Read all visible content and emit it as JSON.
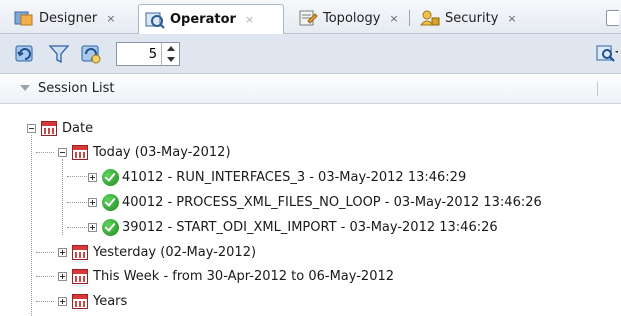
{
  "tabs": [
    {
      "label": "Designer",
      "close": "×",
      "icon": "designer-icon",
      "active": false
    },
    {
      "label": "Operator",
      "close": "×",
      "icon": "operator-icon",
      "active": true
    },
    {
      "label": "Topology",
      "close": "×",
      "icon": "topology-icon",
      "active": false
    },
    {
      "label": "Security",
      "close": "×",
      "icon": "security-icon",
      "active": false
    }
  ],
  "toolbar": {
    "icons": [
      "refresh-icon",
      "filter-icon",
      "connect-icon",
      "search-icon"
    ],
    "count_value": "5"
  },
  "panel": {
    "title": "Session List"
  },
  "tree": {
    "root": {
      "label": "Date",
      "icon": "calendar-icon",
      "expanded": true
    },
    "today": {
      "label": "Today (03-May-2012)",
      "icon": "calendar-icon",
      "expanded": true
    },
    "sessions": [
      {
        "label": "41012 - RUN_INTERFACES_3 - 03-May-2012 13:46:29",
        "status": "success"
      },
      {
        "label": "40012 - PROCESS_XML_FILES_NO_LOOP - 03-May-2012 13:46:26",
        "status": "success"
      },
      {
        "label": "39012 - START_ODI_XML_IMPORT - 03-May-2012 13:46:26",
        "status": "success"
      }
    ],
    "siblings": [
      {
        "label": "Yesterday (02-May-2012)",
        "icon": "calendar-icon",
        "expanded": false
      },
      {
        "label": "This Week - from 30-Apr-2012 to 06-May-2012",
        "icon": "calendar-icon",
        "expanded": false
      },
      {
        "label": "Years",
        "icon": "calendar-icon",
        "expanded": false
      }
    ]
  },
  "colors": {
    "tabbar_bg": "#e6ebf2",
    "toolbar_bg": "#dfe6f0",
    "calendar_red": "#d43a3a",
    "success_green": "#1d8a1d"
  }
}
